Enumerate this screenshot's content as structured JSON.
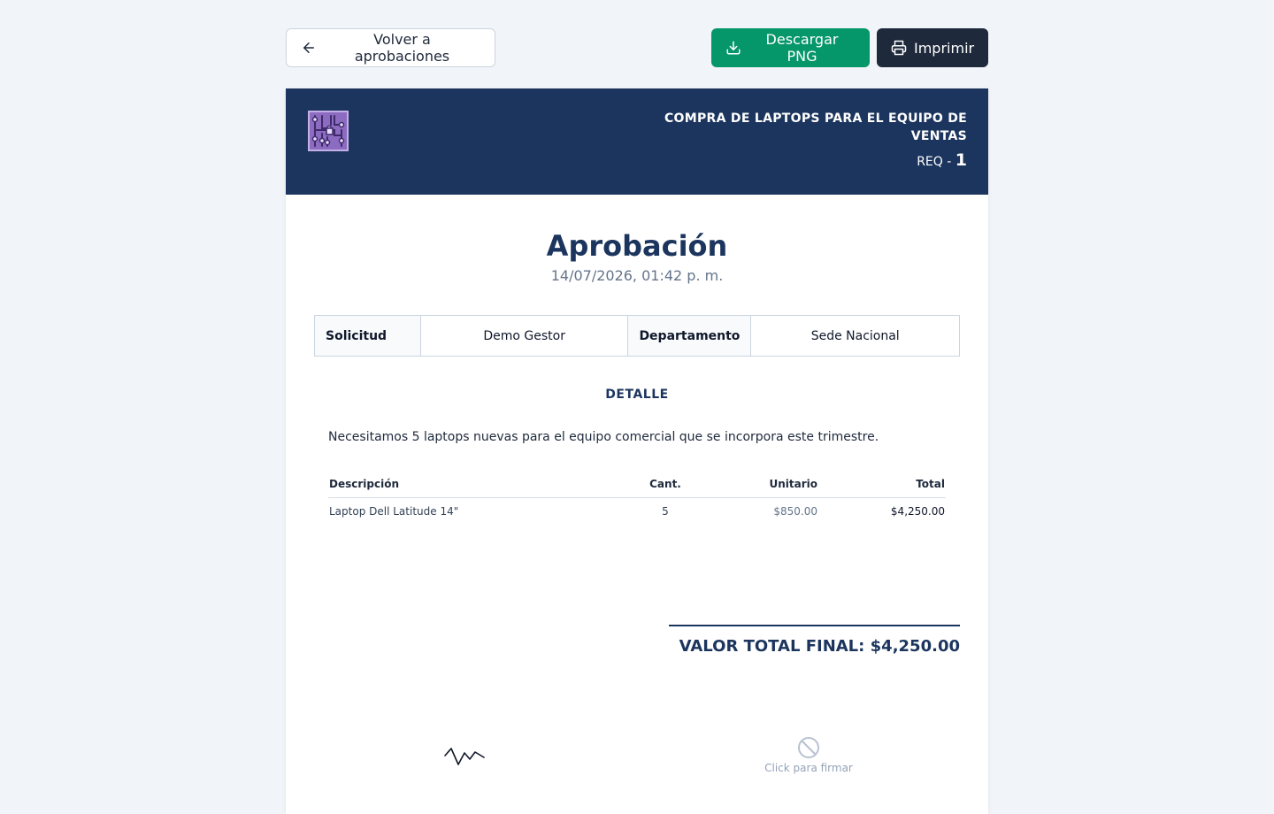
{
  "toolbar": {
    "back_label": "Volver a aprobaciones",
    "download_label": "Descargar PNG",
    "print_label": "Imprimir"
  },
  "header": {
    "title": "COMPRA DE LAPTOPS PARA EL EQUIPO DE VENTAS",
    "req_prefix": "REQ -",
    "req_number": "1",
    "logo_icon": "circuit-board-icon"
  },
  "document": {
    "title": "Aprobación",
    "date": "14/07/2026, 01:42 p. m.",
    "info": {
      "solicitud_label": "Solicitud",
      "solicitud_value": "Demo Gestor",
      "departamento_label": "Departamento",
      "departamento_value": "Sede Nacional"
    },
    "detail_title": "DETALLE",
    "detail_text": "Necesitamos 5 laptops nuevas para el equipo comercial que se incorpora este trimestre.",
    "items_headers": {
      "description": "Descripción",
      "quantity": "Cant.",
      "unit": "Unitario",
      "total": "Total"
    },
    "items": [
      {
        "description": "Laptop Dell Latitude 14\"",
        "quantity": "5",
        "unit": "$850.00",
        "total": "$4,250.00"
      }
    ],
    "total_label": "VALOR TOTAL FINAL:",
    "total_value": "$4,250.00",
    "sign_label": "Click para firmar"
  },
  "colors": {
    "header_bg": "#1c355e",
    "download_button": "#059669",
    "print_button": "#1e293b",
    "logo_purple": "#6b4fa0"
  }
}
